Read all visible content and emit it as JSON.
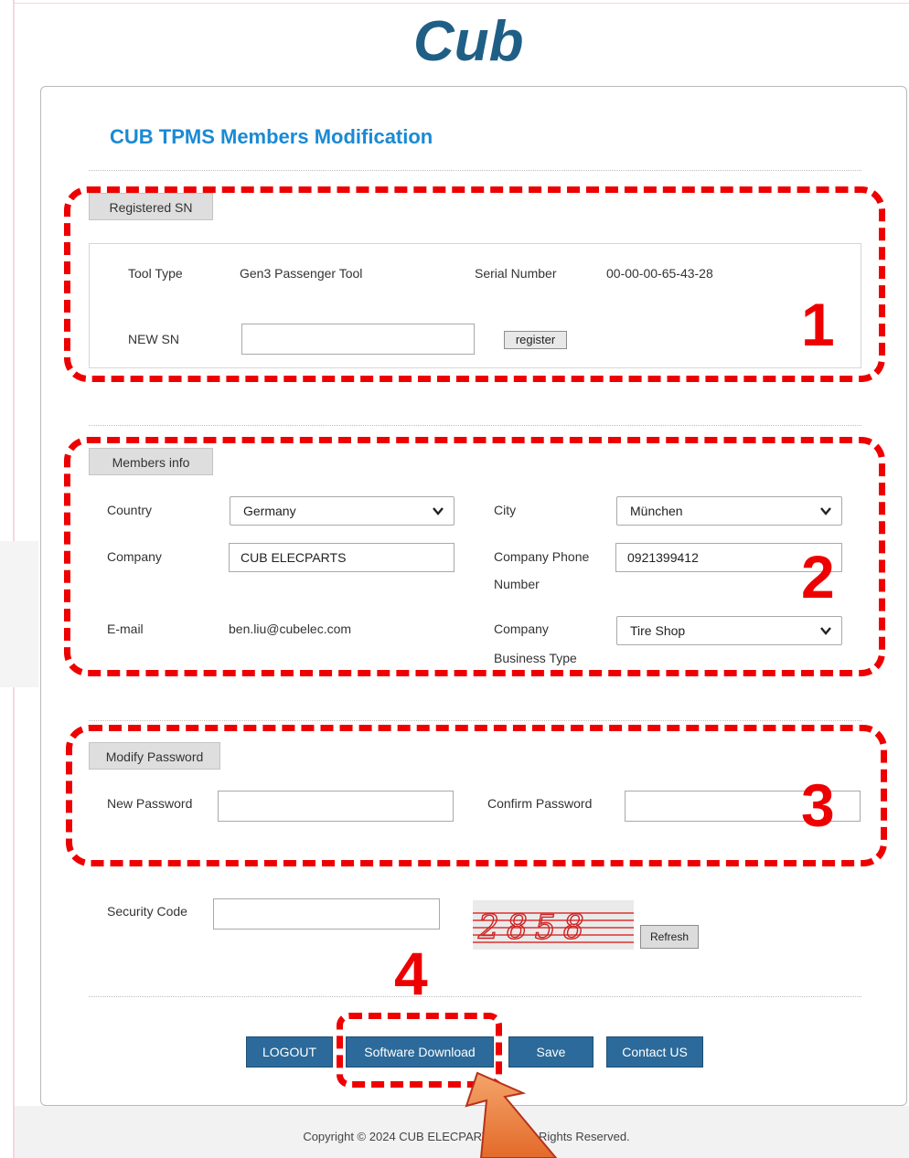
{
  "logo_text": "Cub",
  "title": "CUB TPMS Members Modification",
  "registered": {
    "section_label": "Registered SN",
    "tool_type_label": "Tool Type",
    "tool_type_value": "Gen3 Passenger Tool",
    "serial_label": "Serial Number",
    "serial_value": "00-00-00-65-43-28",
    "new_sn_label": "NEW SN",
    "new_sn_value": "",
    "register_button": "register"
  },
  "members": {
    "section_label": "Members info",
    "country_label": "Country",
    "country_value": "Germany",
    "city_label": "City",
    "city_value": "München",
    "company_label": "Company",
    "company_value": "CUB ELECPARTS",
    "phone_label_line1": "Company Phone",
    "phone_label_line2": "Number",
    "phone_value": "0921399412",
    "email_label": "E-mail",
    "email_value": "ben.liu@cubelec.com",
    "business_label_line1": "Company",
    "business_label_line2": "Business Type",
    "business_value": "Tire Shop"
  },
  "password": {
    "section_label": "Modify Password",
    "new_label": "New Password",
    "confirm_label": "Confirm Password"
  },
  "security": {
    "label": "Security Code",
    "captcha_text": "2858",
    "refresh_button": "Refresh"
  },
  "buttons": {
    "logout": "LOGOUT",
    "software_download": "Software Download",
    "save": "Save",
    "contact": "Contact US"
  },
  "footer": "Copyright © 2024 CUB ELECPARTS Inc. All Rights Reserved.",
  "annotations": {
    "n1": "1",
    "n2": "2",
    "n3": "3",
    "n4": "4"
  },
  "colors": {
    "title_blue": "#1a8ad4",
    "button_blue": "#2b6a9a",
    "annotation_red": "#ee0000",
    "logo_blue": "#1f5f86"
  }
}
